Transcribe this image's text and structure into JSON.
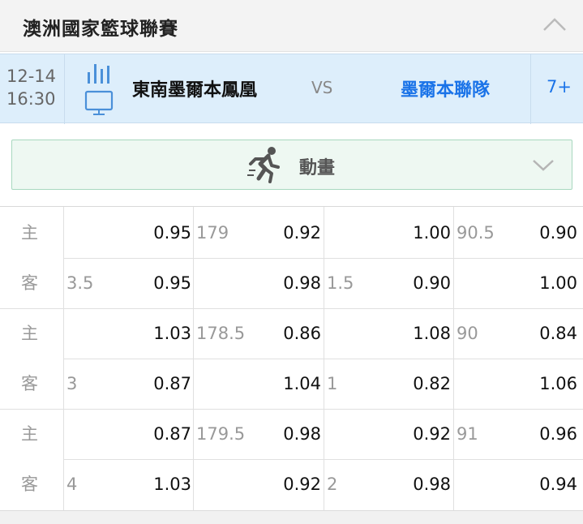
{
  "league": {
    "title": "澳洲國家籃球聯賽",
    "collapse_icon": "chevron-up-icon"
  },
  "match": {
    "date": "12-14",
    "time": "16:30",
    "live_icon": "live-stats-tv-icon",
    "home_team": "東南墨爾本鳳凰",
    "vs": "VS",
    "away_team": "墨爾本聯隊",
    "more": "7+"
  },
  "animation": {
    "label": "動畫",
    "icon": "runner-icon",
    "expand_icon": "chevron-down-icon"
  },
  "odds": [
    {
      "home": {
        "side": "主",
        "spread_line": "",
        "spread_odds": "0.95",
        "total_line": "179",
        "total_odds": "0.92",
        "half_line": "",
        "half_odds": "1.00",
        "half_total_line": "90.5",
        "half_total_odds": "0.90"
      },
      "away": {
        "side": "客",
        "spread_line": "3.5",
        "spread_odds": "0.95",
        "total_line": "",
        "total_odds": "0.98",
        "half_line": "1.5",
        "half_odds": "0.90",
        "half_total_line": "",
        "half_total_odds": "1.00"
      }
    },
    {
      "home": {
        "side": "主",
        "spread_line": "",
        "spread_odds": "1.03",
        "total_line": "178.5",
        "total_odds": "0.86",
        "half_line": "",
        "half_odds": "1.08",
        "half_total_line": "90",
        "half_total_odds": "0.84"
      },
      "away": {
        "side": "客",
        "spread_line": "3",
        "spread_odds": "0.87",
        "total_line": "",
        "total_odds": "1.04",
        "half_line": "1",
        "half_odds": "0.82",
        "half_total_line": "",
        "half_total_odds": "1.06"
      }
    },
    {
      "home": {
        "side": "主",
        "spread_line": "",
        "spread_odds": "0.87",
        "total_line": "179.5",
        "total_odds": "0.98",
        "half_line": "",
        "half_odds": "0.92",
        "half_total_line": "91",
        "half_total_odds": "0.96"
      },
      "away": {
        "side": "客",
        "spread_line": "4",
        "spread_odds": "1.03",
        "total_line": "",
        "total_odds": "0.92",
        "half_line": "2",
        "half_odds": "0.98",
        "half_total_line": "",
        "half_total_odds": "0.94"
      }
    }
  ],
  "colors": {
    "accent": "#1a73e8",
    "match_bg": "#ddeefb",
    "animation_bg": "#eef8f2",
    "animation_border": "#a8d8bf"
  }
}
